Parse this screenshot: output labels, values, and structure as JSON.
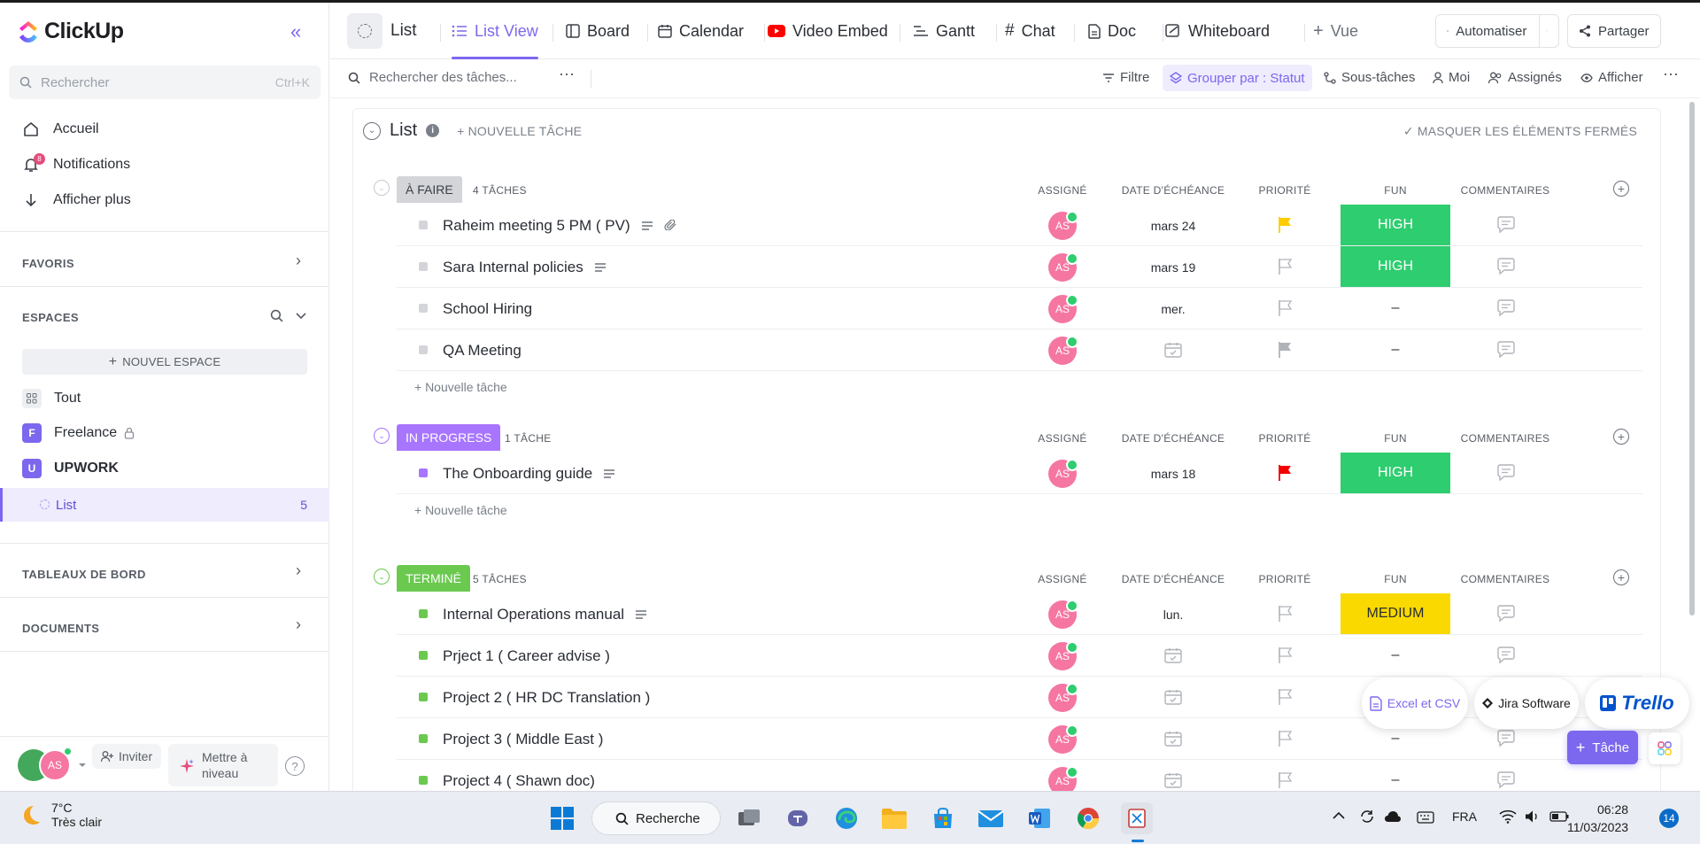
{
  "app": {
    "name": "ClickUp",
    "brand_color": "#7b68ee"
  },
  "sidebar": {
    "search_placeholder": "Rechercher",
    "search_shortcut": "Ctrl+K",
    "nav": [
      {
        "label": "Accueil",
        "icon": "home-icon"
      },
      {
        "label": "Notifications",
        "icon": "bell-icon",
        "badge": "8"
      },
      {
        "label": "Afficher plus",
        "icon": "arrow-down-icon"
      }
    ],
    "favoris": "FAVORIS",
    "espaces": "ESPACES",
    "new_space": "NOUVEL ESPACE",
    "spaces": [
      {
        "label": "Tout",
        "letter": ""
      },
      {
        "label": "Freelance",
        "letter": "F",
        "color": "#7b68ee"
      },
      {
        "label": "UPWORK",
        "letter": "U",
        "color": "#7b68ee"
      }
    ],
    "active_list": {
      "label": "List",
      "count": "5"
    },
    "tableaux": "TABLEAUX DE BORD",
    "documents": "DOCUMENTS",
    "bottom": {
      "avatar": "AS",
      "invite": "Inviter",
      "upgrade": "Mettre à niveau",
      "help": "?"
    }
  },
  "topnav": {
    "list_title": "List",
    "tabs": [
      {
        "label": "List View",
        "icon": "list-icon",
        "active": true
      },
      {
        "label": "Board",
        "icon": "board-icon"
      },
      {
        "label": "Calendar",
        "icon": "calendar-icon"
      },
      {
        "label": "Video Embed",
        "icon": "youtube-icon"
      },
      {
        "label": "Gantt",
        "icon": "gantt-icon"
      },
      {
        "label": "Chat",
        "icon": "hash-icon"
      },
      {
        "label": "Doc",
        "icon": "doc-icon"
      },
      {
        "label": "Whiteboard",
        "icon": "whiteboard-icon"
      },
      {
        "label": "Vue",
        "icon": "plus-icon"
      }
    ],
    "automate": "Automatiser",
    "share": "Partager"
  },
  "toolbar": {
    "search_placeholder": "Rechercher des tâches...",
    "filter": "Filtre",
    "group_by": "Grouper par : Statut",
    "subtasks": "Sous-tâches",
    "me": "Moi",
    "assignees": "Assignés",
    "show": "Afficher"
  },
  "list": {
    "title": "List",
    "new_task": "+ NOUVELLE TÂCHE",
    "hide_closed": "MASQUER LES ÉLÉMENTS FERMÉS",
    "columns": {
      "assignee": "ASSIGNÉ",
      "due": "DATE D'ÉCHÉANCE",
      "priority": "PRIORITÉ",
      "fun": "FUN",
      "comments": "COMMENTAIRES"
    },
    "new_task_row": "+ Nouvelle tâche",
    "groups": [
      {
        "status": "À FAIRE",
        "count": "4 TÂCHES",
        "color": "#d3d5d9",
        "text_color": "#3b4048",
        "sq_color": "#d3d5d9",
        "tasks": [
          {
            "name": "Raheim meeting 5 PM ( PV)",
            "desc": true,
            "attach": true,
            "assignee": "AS",
            "due": "mars 24",
            "priority": "yellow",
            "fun": "HIGH"
          },
          {
            "name": "Sara Internal policies",
            "desc": true,
            "assignee": "AS",
            "due": "mars 19",
            "priority": "none",
            "fun": "HIGH"
          },
          {
            "name": "School Hiring",
            "assignee": "AS",
            "due": "mer.",
            "priority": "none",
            "fun": "–"
          },
          {
            "name": "QA Meeting",
            "assignee": "AS",
            "due": "",
            "priority": "grey",
            "fun": "–"
          }
        ]
      },
      {
        "status": "IN PROGRESS",
        "count": "1 TÂCHE",
        "color": "#a875ff",
        "text_color": "#ffffff",
        "sq_color": "#a875ff",
        "tasks": [
          {
            "name": "The Onboarding guide",
            "desc": true,
            "assignee": "AS",
            "due": "mars 18",
            "priority": "red",
            "fun": "HIGH"
          }
        ]
      },
      {
        "status": "TERMINÉ",
        "count": "5 TÂCHES",
        "color": "#6bc950",
        "text_color": "#ffffff",
        "sq_color": "#6bc950",
        "tasks": [
          {
            "name": "Internal Operations manual",
            "desc": true,
            "assignee": "AS",
            "due": "lun.",
            "priority": "none",
            "fun": "MEDIUM"
          },
          {
            "name": "Prject 1 ( Career advise )",
            "assignee": "AS",
            "due": "",
            "priority": "none",
            "fun": "–"
          },
          {
            "name": "Project 2 ( HR DC Translation )",
            "assignee": "AS",
            "due": "",
            "priority": "none",
            "fun": ""
          },
          {
            "name": "Project 3 ( Middle East )",
            "assignee": "AS",
            "due": "",
            "priority": "none",
            "fun": "–"
          },
          {
            "name": "Project 4 ( Shawn doc)",
            "assignee": "AS",
            "due": "",
            "priority": "none",
            "fun": "–"
          }
        ]
      }
    ]
  },
  "floating": {
    "excel": "Excel et CSV",
    "jira": "Jira Software",
    "trello": "Trello",
    "task": "Tâche"
  },
  "taskbar": {
    "temp": "7°C",
    "weather": "Très clair",
    "search": "Recherche",
    "lang": "FRA",
    "time": "06:28",
    "date": "11/03/2023",
    "notif_count": "14"
  }
}
